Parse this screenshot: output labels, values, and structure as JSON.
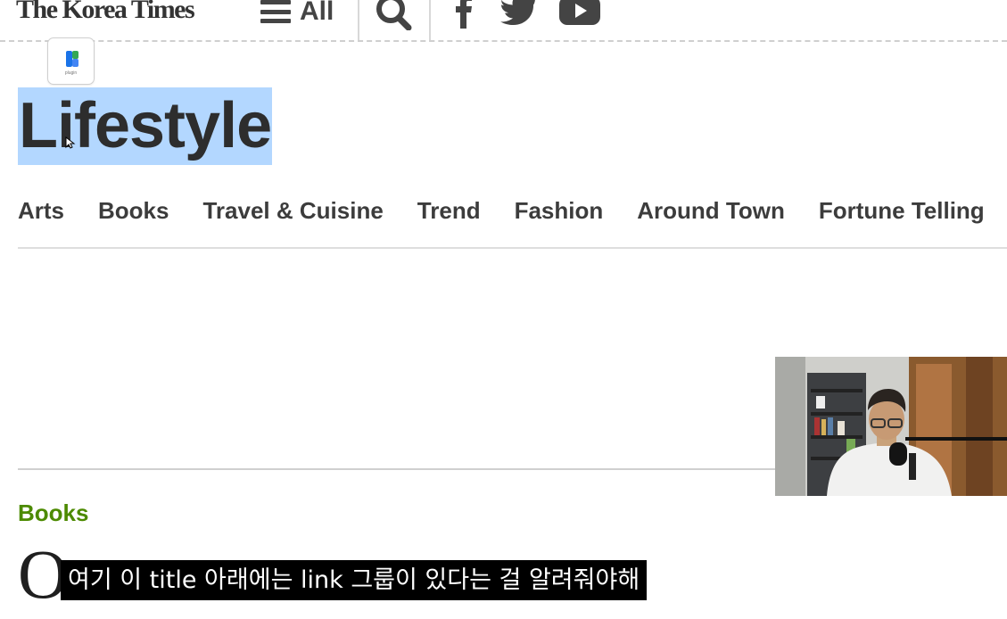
{
  "header": {
    "logo": "The Korea Times",
    "menu_label": "All",
    "icons": [
      "menu-icon",
      "search-icon",
      "facebook-icon",
      "twitter-icon",
      "youtube-icon"
    ]
  },
  "extension_badge": {
    "caption": "plugin"
  },
  "section": {
    "title": "Lifestyle",
    "nav": [
      "Arts",
      "Books",
      "Travel & Cuisine",
      "Trend",
      "Fashion",
      "Around Town",
      "Fortune Telling"
    ]
  },
  "article": {
    "category": "Books",
    "headline_partial": "O"
  },
  "overlay": {
    "subtitle": "여기 이 title 아래에는 link 그룹이 있다는 걸 알려줘야해"
  },
  "colors": {
    "selection": "#b3d7ff",
    "category_green": "#4c8a00",
    "text_dark": "#2d2d2d"
  }
}
